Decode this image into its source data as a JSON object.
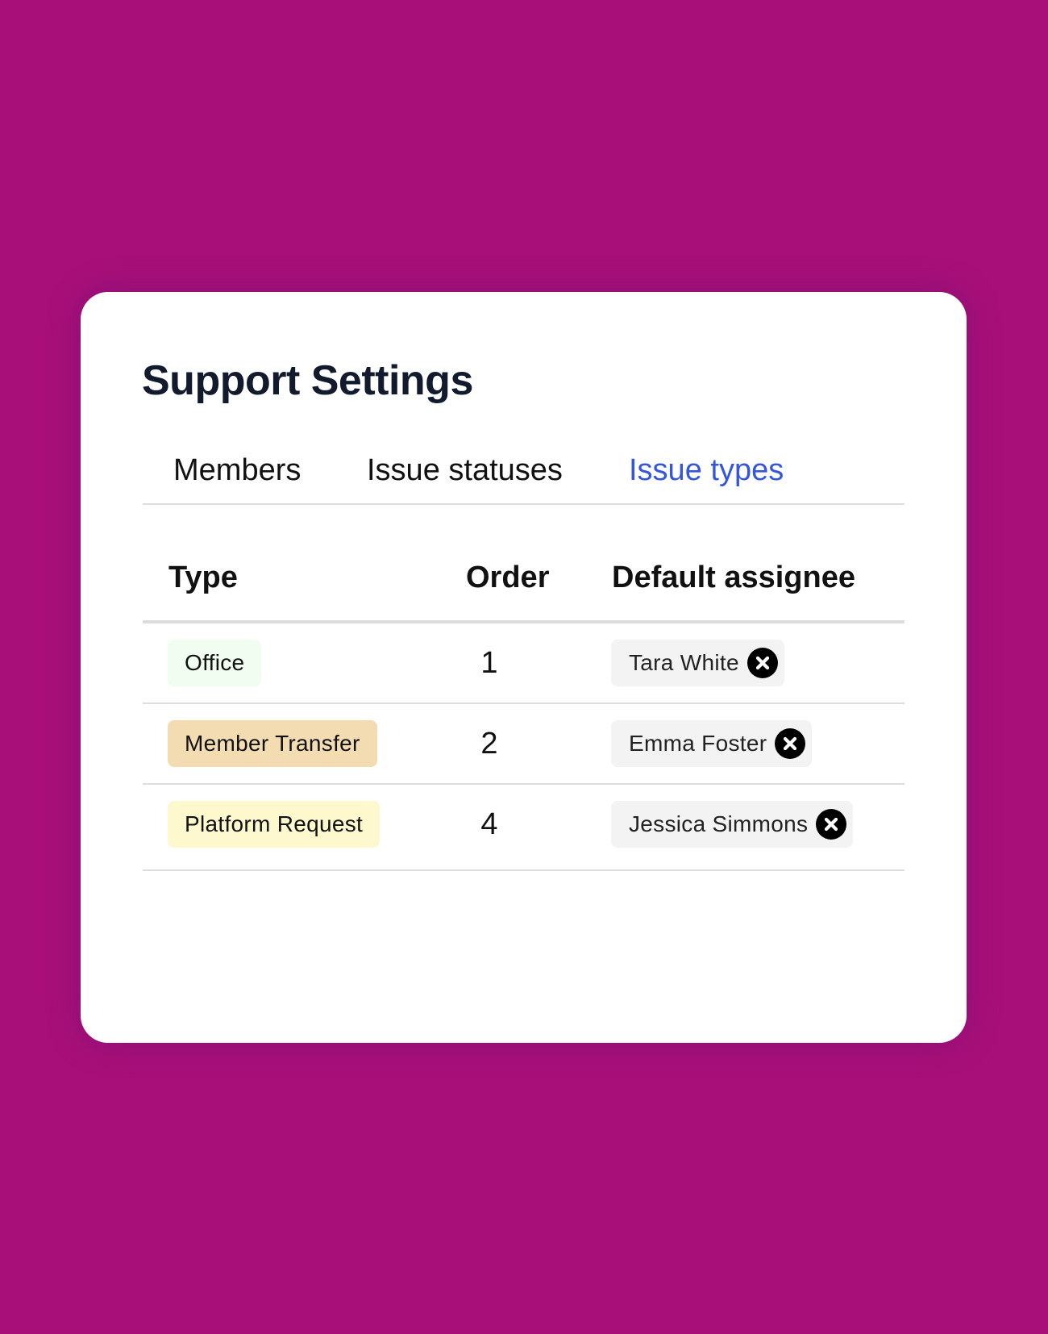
{
  "page": {
    "title": "Support Settings"
  },
  "tabs": [
    {
      "label": "Members",
      "active": false
    },
    {
      "label": "Issue statuses",
      "active": false
    },
    {
      "label": "Issue types",
      "active": true
    }
  ],
  "table": {
    "headers": {
      "type": "Type",
      "order": "Order",
      "assignee": "Default assignee"
    },
    "rows": [
      {
        "type": "Office",
        "type_color": "#f0fdf0",
        "order": "1",
        "assignee": "Tara White",
        "remove_icon": "close-circle-icon"
      },
      {
        "type": "Member Transfer",
        "type_color": "#f3dcb2",
        "order": "2",
        "assignee": "Emma Foster",
        "remove_icon": "close-circle-icon"
      },
      {
        "type": "Platform Request",
        "type_color": "#fef8ce",
        "order": "4",
        "assignee": "Jessica Simmons",
        "remove_icon": "close-circle-icon"
      }
    ]
  },
  "colors": {
    "background": "#a80f78",
    "card": "#ffffff",
    "active_tab": "#3355e0",
    "title": "#121a2e"
  }
}
